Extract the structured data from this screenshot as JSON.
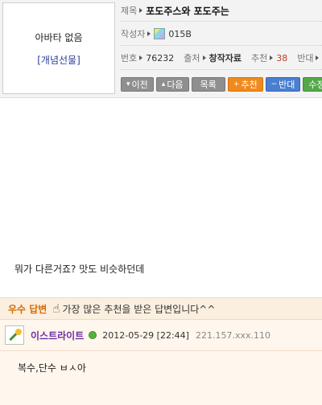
{
  "post": {
    "avatar": {
      "no_avatar_text": "아바타 없음",
      "group_tag": "[개념선물]"
    },
    "title_label": "제목",
    "title": "포도주스와 포도주는",
    "author_label": "작성자",
    "author": "015B",
    "number_label": "번호",
    "number": "76232",
    "source_label": "출처",
    "source": "창작자료",
    "recommend_label": "추천",
    "recommend_count": "38",
    "oppose_label": "반대",
    "body": "뭐가 다른거죠? 맛도 비슷하던데"
  },
  "toolbar": {
    "prev": "이전",
    "next": "다음",
    "list": "목록",
    "recommend": "추천",
    "oppose": "반대",
    "edit": "수정"
  },
  "best_answer": {
    "label": "우수 답변",
    "description": "가장 많은 추천을 받은 답변입니다^^"
  },
  "reply": {
    "author": "이스트라이트",
    "datetime": "2012-05-29 [22:44]",
    "ip": "221.157.xxx.110",
    "text": "복수,단수 ㅂㅅ아"
  },
  "colors": {
    "orange": "#f08a1e",
    "blue": "#4a7fd0",
    "green": "#55a84a",
    "purple_name": "#6b2fa3",
    "best_label": "#d86a00"
  },
  "icons": [
    "author-level-icon",
    "chevron-down-icon",
    "chevron-up-icon",
    "plus-icon",
    "minus-icon",
    "pointing-hand-icon",
    "reply-avatar-icon",
    "online-status-icon"
  ]
}
